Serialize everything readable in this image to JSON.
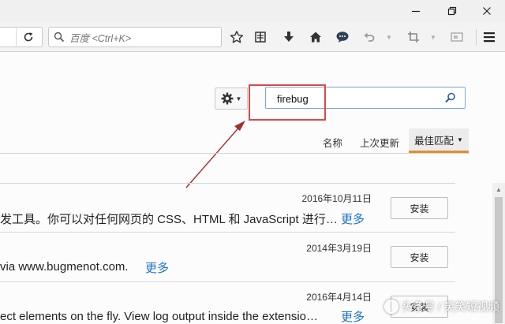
{
  "window": {
    "minimize_icon": "minimize-icon",
    "maximize_icon": "restore-icon",
    "close_icon": "close-icon"
  },
  "toolbar": {
    "search_placeholder": "百度 <Ctrl+K>",
    "icons": [
      "reload-icon",
      "bookmark-star-icon",
      "reading-list-icon",
      "download-icon",
      "home-icon",
      "chat-icon",
      "undo-icon",
      "crop-icon",
      "screenshot-icon",
      "menu-icon"
    ]
  },
  "addons": {
    "search_value": "firebug",
    "sort": {
      "name": "名称",
      "last_updated": "上次更新",
      "best_match": "最佳匹配"
    },
    "items": [
      {
        "date": "2016年10月11日",
        "description": "发工具。你可以对任何网页的 CSS、HTML 和 JavaScript 进行…",
        "more": "更多",
        "install": "安装"
      },
      {
        "date": "2014年3月19日",
        "description": "via www.bugmenot.com.",
        "more": "更多",
        "install": "安装"
      },
      {
        "date": "2016年4月14日",
        "description": "ect elements on the fly. View log output inside the extensio…",
        "more": "更多",
        "install": "安装"
      }
    ]
  },
  "watermark": "头条号 / 笑笑短视频",
  "colors": {
    "accent_orange": "#e38d2d",
    "link_blue": "#1a73c8",
    "annotation_red": "#d84a4a"
  }
}
